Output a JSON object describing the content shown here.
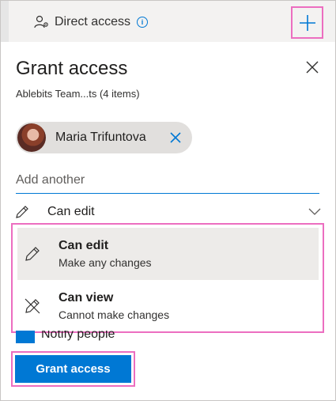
{
  "header": {
    "title": "Direct access",
    "people_icon": "people-settings-icon",
    "info_icon": "info-icon",
    "add_icon": "plus-icon",
    "accent_color": "#0078d4",
    "highlight_color": "#ec6ec0"
  },
  "panel": {
    "title": "Grant access",
    "subtitle": "Ablebits Team...ts (4 items)",
    "close_icon": "close-icon"
  },
  "recipient": {
    "name": "Maria Trifuntova",
    "remove_icon": "close-icon"
  },
  "add_input": {
    "placeholder": "Add another",
    "value": ""
  },
  "permission": {
    "selected": "Can edit",
    "icon": "pencil-icon",
    "chevron": "chevron-down-icon",
    "options": [
      {
        "title": "Can edit",
        "description": "Make any changes",
        "icon": "pencil-icon"
      },
      {
        "title": "Can view",
        "description": "Cannot make changes",
        "icon": "pencil-crossed-icon"
      }
    ]
  },
  "notify": {
    "label": "Notify people",
    "checked": true
  },
  "actions": {
    "grant_label": "Grant access"
  }
}
